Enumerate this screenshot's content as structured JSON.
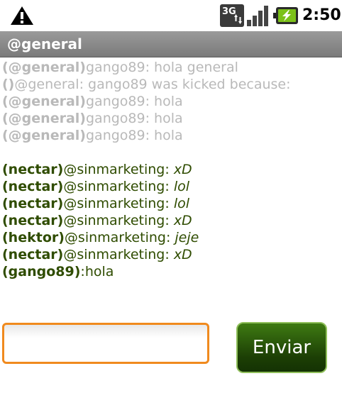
{
  "status_bar": {
    "time": "2:50",
    "network_label": "3G",
    "icons": [
      "warning-icon",
      "3g-icon",
      "signal-icon",
      "battery-charging-icon"
    ]
  },
  "header": {
    "title": "@general"
  },
  "messages_old": [
    {
      "sender": "(@general)",
      "text": "gango89: hola general"
    },
    {
      "sender": "()",
      "text": "@general: gango89 was kicked because:"
    },
    {
      "sender": "(@general)",
      "text": "gango89: hola"
    },
    {
      "sender": "(@general)",
      "text": "gango89: hola"
    },
    {
      "sender": "(@general)",
      "text": "gango89: hola"
    }
  ],
  "messages_new": [
    {
      "sender": "(nectar)",
      "prefix": "@sinmarketing: ",
      "text": "xD"
    },
    {
      "sender": "(nectar)",
      "prefix": "@sinmarketing: ",
      "text": "lol"
    },
    {
      "sender": "(nectar)",
      "prefix": "@sinmarketing: ",
      "text": "lol"
    },
    {
      "sender": "(nectar)",
      "prefix": "@sinmarketing: ",
      "text": "xD"
    },
    {
      "sender": "(hektor)",
      "prefix": "@sinmarketing: ",
      "text": "jeje"
    },
    {
      "sender": "(nectar)",
      "prefix": "@sinmarketing: ",
      "text": "xD"
    },
    {
      "sender": "(gango89)",
      "prefix": ":hola",
      "text": ""
    }
  ],
  "composer": {
    "input_value": "",
    "send_label": "Enviar"
  },
  "colors": {
    "old_message": "#b9b9b9",
    "new_message": "#2f4c00",
    "input_border": "#f08a1e",
    "send_button": "#1c3f05"
  }
}
